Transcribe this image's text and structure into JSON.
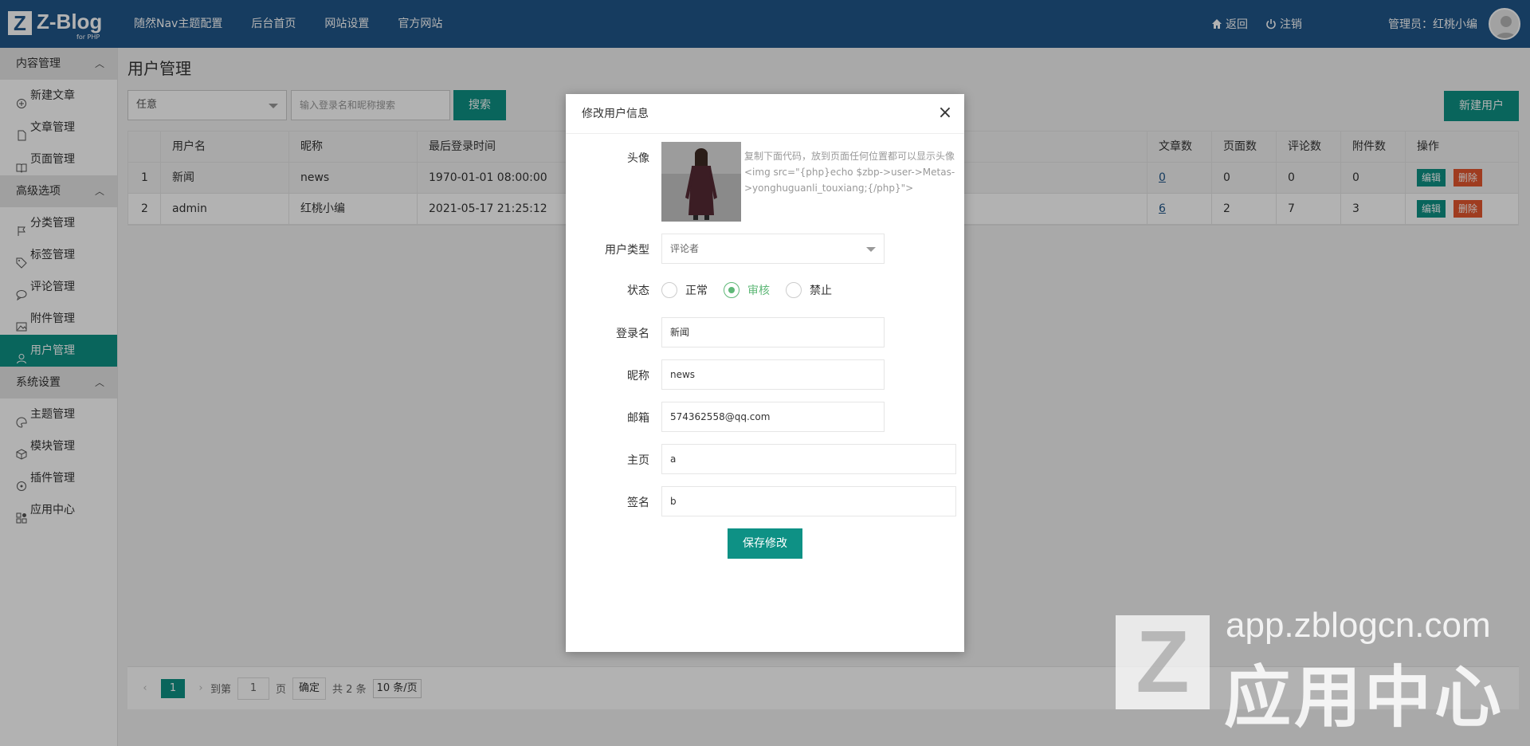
{
  "header": {
    "logo_letter": "Z",
    "logo_text": "Z-Blog",
    "logo_sub": "for PHP",
    "nav": [
      "随然Nav主题配置",
      "后台首页",
      "网站设置",
      "官方网站"
    ],
    "back_label": "返回",
    "logout_label": "注销",
    "admin_label": "管理员：红桃小编"
  },
  "sidebar": {
    "groups": [
      {
        "label": "内容管理",
        "items": [
          "新建文章",
          "文章管理",
          "页面管理"
        ]
      },
      {
        "label": "高级选项",
        "items": [
          "分类管理",
          "标签管理",
          "评论管理",
          "附件管理",
          "用户管理"
        ]
      },
      {
        "label": "系统设置",
        "items": [
          "主题管理",
          "模块管理",
          "插件管理",
          "应用中心"
        ]
      }
    ],
    "active": "用户管理"
  },
  "main": {
    "title": "用户管理",
    "filter_value": "任意",
    "search_placeholder": "输入登录名和昵称搜索",
    "search_button": "搜索",
    "new_user_button": "新建用户",
    "table": {
      "headers": [
        "用户名",
        "昵称",
        "最后登录时间",
        "文章数",
        "页面数",
        "评论数",
        "附件数",
        "操作"
      ],
      "rows": [
        {
          "index": "1",
          "username": "新闻",
          "nickname": "news",
          "last_login": "1970-01-01 08:00:00",
          "articles": "0",
          "pages": "0",
          "comments": "0",
          "attachments": "0"
        },
        {
          "index": "2",
          "username": "admin",
          "nickname": "红桃小编",
          "last_login": "2021-05-17 21:25:12",
          "articles": "6",
          "pages": "2",
          "comments": "7",
          "attachments": "3"
        }
      ],
      "edit_label": "编辑",
      "delete_label": "删除"
    },
    "pager": {
      "prev": "‹",
      "current": "1",
      "next": "›",
      "goto_label": "到第",
      "goto_value": "1",
      "page_label": "页",
      "ok_label": "确定",
      "total_label": "共 2 条",
      "size_label": "10 条/页"
    }
  },
  "modal": {
    "title": "修改用户信息",
    "avatar_label": "头像",
    "avatar_hint": "复制下面代码，放到页面任何位置都可以显示头像<img src=\"{php}echo $zbp->user->Metas->yonghuguanli_touxiang;{/php}\">",
    "user_type_label": "用户类型",
    "user_type_value": "评论者",
    "status_label": "状态",
    "status_options": [
      "正常",
      "审核",
      "禁止"
    ],
    "status_selected": "审核",
    "login_label": "登录名",
    "login_value": "新闻",
    "nickname_label": "昵称",
    "nickname_value": "news",
    "email_label": "邮箱",
    "email_value": "574362558@qq.com",
    "homepage_label": "主页",
    "homepage_value": "a",
    "signature_label": "签名",
    "signature_value": "b",
    "save_button": "保存修改"
  },
  "watermark": {
    "letter": "Z",
    "url": "app.zblogcn.com",
    "text": "应用中心"
  },
  "colors": {
    "header": "#20568a",
    "accent": "#0e9185",
    "danger": "#e4572e",
    "radio_checked": "#5fb878"
  }
}
